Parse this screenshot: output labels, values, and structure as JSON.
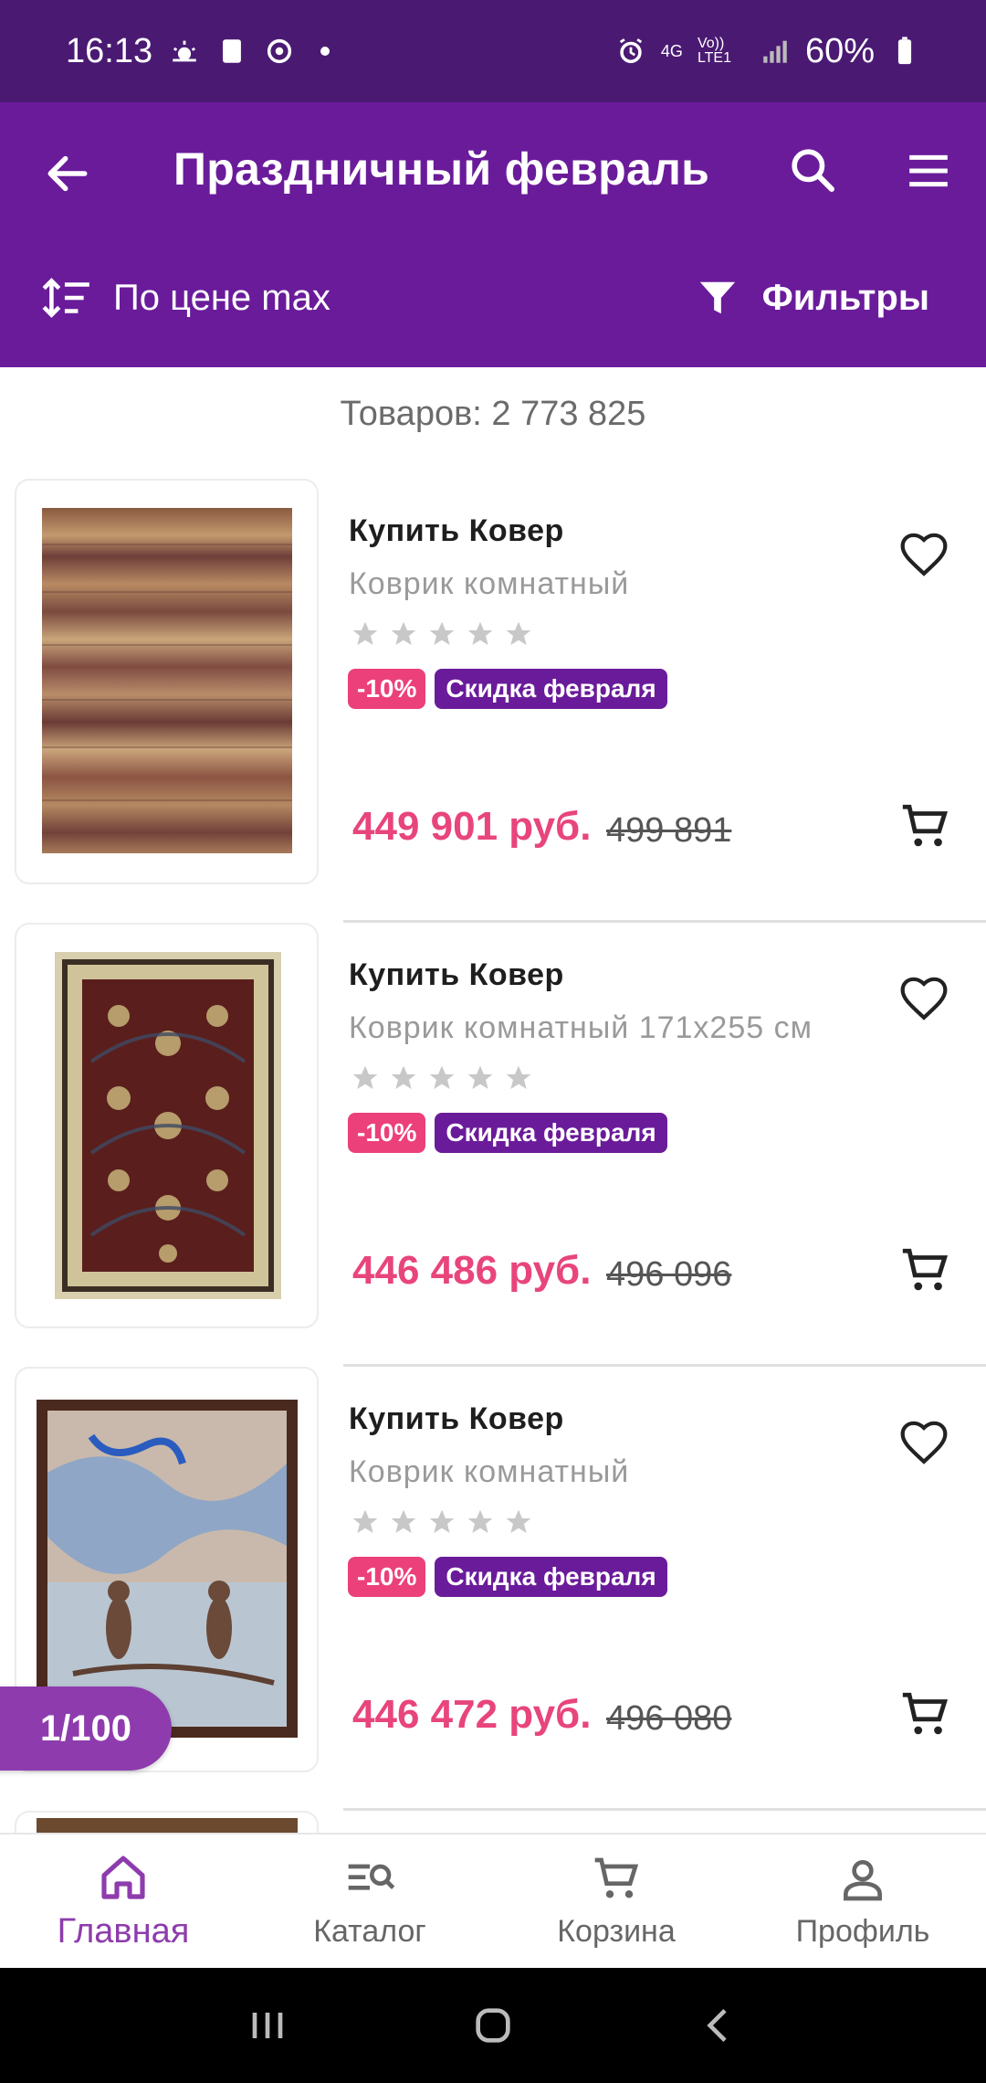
{
  "status_bar": {
    "time": "16:13",
    "battery": "60%",
    "network_4g": "4G",
    "volte": "Vo)) LTE1"
  },
  "header": {
    "title": "Праздничный февраль",
    "sort_label": "По цене max",
    "filter_label": "Фильтры"
  },
  "count_text": "Товаров: 2 773 825",
  "products": [
    {
      "name": "Купить Ковер",
      "desc": "Коврик комнатный",
      "rating": 0,
      "discount": "-10%",
      "promo": "Скидка февраля",
      "price": "449 901 руб.",
      "old_price": "499 891"
    },
    {
      "name": "Купить Ковер",
      "desc": "Коврик комнатный 171x255 см",
      "rating": 0,
      "discount": "-10%",
      "promo": "Скидка февраля",
      "price": "446 486 руб.",
      "old_price": "496 096"
    },
    {
      "name": "Купить Ковер",
      "desc": "Коврик комнатный",
      "rating": 0,
      "discount": "-10%",
      "promo": "Скидка февраля",
      "price": "446 472 руб.",
      "old_price": "496 080"
    }
  ],
  "page_indicator": "1/100",
  "bottom_nav": [
    {
      "label": "Главная",
      "icon": "home-icon",
      "active": true
    },
    {
      "label": "Каталог",
      "icon": "catalog-search-icon",
      "active": false
    },
    {
      "label": "Корзина",
      "icon": "cart-icon",
      "active": false
    },
    {
      "label": "Профиль",
      "icon": "profile-icon",
      "active": false
    }
  ],
  "colors": {
    "status_bar": "#4a1a73",
    "app_bar": "#6a1b9a",
    "price": "#e8457b",
    "discount": "#ec407a",
    "active_nav": "#8e3cad"
  }
}
